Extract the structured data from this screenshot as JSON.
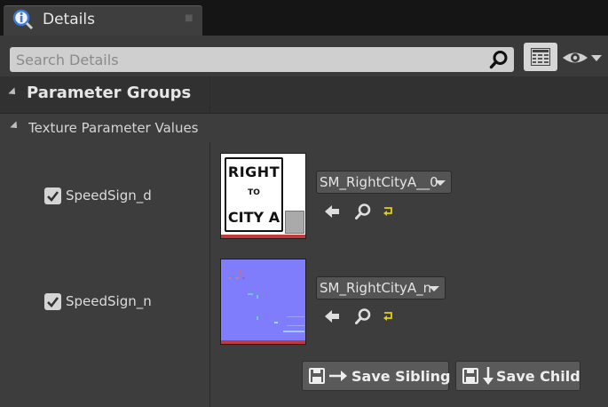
{
  "tab": {
    "title": "Details",
    "icon": "details-info-icon"
  },
  "search": {
    "placeholder": "Search Details",
    "value": ""
  },
  "toolbar": {
    "grid_icon": "property-matrix-icon",
    "eye_icon": "visibility-eye-icon"
  },
  "groups": {
    "label": "Parameter Groups"
  },
  "section": {
    "label": "Texture Parameter Values"
  },
  "params": [
    {
      "name": "SpeedSign_d",
      "checked": true,
      "asset": "SM_RightCityA__0",
      "thumbnail": {
        "line1": "RIGHT",
        "line2": "TO",
        "line3": "CITY A"
      }
    },
    {
      "name": "SpeedSign_n",
      "checked": true,
      "asset": "SM_RightCityA_n"
    }
  ],
  "actions": {
    "save_sibling": "Save Sibling",
    "save_child": "Save Child"
  },
  "colors": {
    "accent_strip": "#c0393b",
    "normal_map": "#7f7dfb",
    "panel": "#3d3d3d"
  }
}
